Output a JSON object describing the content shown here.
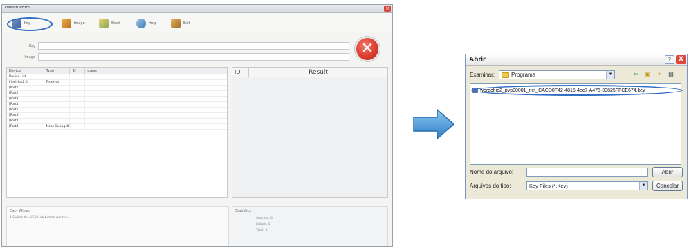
{
  "app": {
    "title": "FlexestDVBFro",
    "toolbar": {
      "items": [
        {
          "label": "Key",
          "icon": "key-icon"
        },
        {
          "label": "Image",
          "icon": "image-icon"
        },
        {
          "label": "Start",
          "icon": "start-icon"
        },
        {
          "label": "Help",
          "icon": "help-icon"
        },
        {
          "label": "Exit",
          "icon": "exit-icon"
        }
      ]
    },
    "fields": {
      "key_label": "Key",
      "image_label": "Image"
    },
    "device_table": {
      "headers": [
        "Device",
        "Type",
        "ID",
        "gress"
      ],
      "rows": [
        [
          "Device List",
          "",
          "",
          ""
        ],
        [
          "FlexiHub2.0",
          "FlexiHub",
          "",
          ""
        ],
        [
          "[Port1]",
          "",
          "",
          ""
        ],
        [
          "[Port2]",
          "",
          "",
          ""
        ],
        [
          "[Port3]",
          "",
          "",
          ""
        ],
        [
          "[Port4]",
          "",
          "",
          ""
        ],
        [
          "[Port5]",
          "",
          "",
          ""
        ],
        [
          "[Port6]",
          "",
          "",
          ""
        ],
        [
          "[Port7]",
          "",
          "",
          ""
        ],
        [
          "[Port8]",
          "Mass StorageD",
          "",
          ""
        ]
      ]
    },
    "result_table": {
      "id_header": "ID",
      "result_header": "Result"
    },
    "wizard": {
      "title": "Easy Wizard",
      "lines": [
        "1.Switch the USB Hub button run the ..."
      ]
    },
    "stats": {
      "title": "Statistics",
      "lines": [
        "Success: 0",
        "Failure: 0",
        "Total: 0"
      ]
    }
  },
  "dialog": {
    "title": "Abrir",
    "help_glyph": "?",
    "close_glyph": "X",
    "look_in_label": "Examinar:",
    "look_in_value": "Programa",
    "file": "wordchip2_pvp00001_net_CACD0F42-4815-4ec7-A475-33825FFCE674.key",
    "filename_label": "Nome do arquivo:",
    "filename_value": "",
    "filetype_label": "Arquivos do tipo:",
    "filetype_value": "Key Files (*.Key)",
    "open_button": "Abrir",
    "cancel_button": "Cancelar"
  },
  "colors": {
    "highlight": "#2f6fc4",
    "arrow": "#3a8fd8",
    "error_circle": "#d63a2b"
  }
}
